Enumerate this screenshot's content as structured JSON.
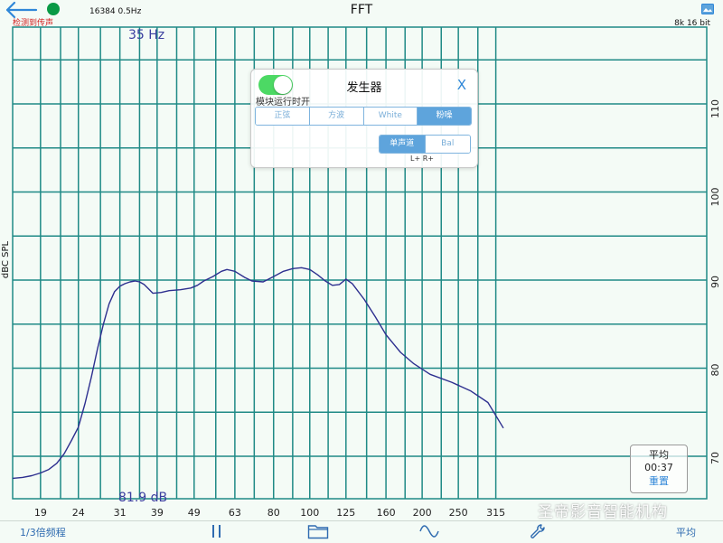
{
  "header": {
    "title": "FFT",
    "back_sublabel": "检测到传声",
    "fft_info": "16384  0.5Hz",
    "bit_info": "8k 16 bit"
  },
  "plot": {
    "y_axis_label": "dBC SPL",
    "freq_readout": "35 Hz",
    "db_readout": "81.9 dB",
    "x_ticks": [
      "19",
      "24",
      "31",
      "39",
      "49",
      "63",
      "80",
      "100",
      "125",
      "160",
      "200",
      "250",
      "315"
    ],
    "y_ticks": [
      "110",
      "100",
      "90",
      "80",
      "70"
    ],
    "grid_color": "#1f8a86",
    "curve_color": "#2d2f8f"
  },
  "chart_data": {
    "type": "line",
    "xlabel": "",
    "ylabel": "dBC SPL",
    "x_scale": "log",
    "ylim": [
      67,
      117
    ],
    "series": [
      {
        "x": [
          16,
          17,
          18,
          19,
          20,
          21,
          22,
          23,
          24,
          25,
          26,
          27,
          28,
          29,
          30,
          31,
          32,
          33,
          34,
          35,
          36,
          37,
          38,
          40,
          42,
          45,
          48,
          50,
          52,
          55,
          58,
          60,
          63,
          67,
          70,
          75,
          80,
          85,
          90,
          95,
          100,
          105,
          110,
          115,
          120,
          125,
          130,
          140,
          150,
          160,
          175,
          190,
          210,
          240,
          270,
          300,
          330
        ],
        "y": [
          67.5,
          67.6,
          67.8,
          68.1,
          68.5,
          69.2,
          70.3,
          71.8,
          73.3,
          76.0,
          79.0,
          82.2,
          85.0,
          87.3,
          88.7,
          89.3,
          89.6,
          89.8,
          89.9,
          89.8,
          89.5,
          89.0,
          88.5,
          88.6,
          88.8,
          88.9,
          89.1,
          89.4,
          89.9,
          90.4,
          91.0,
          91.2,
          91.0,
          90.3,
          89.9,
          89.8,
          90.4,
          91.0,
          91.3,
          91.4,
          91.2,
          90.6,
          89.9,
          89.4,
          89.5,
          90.1,
          89.6,
          87.8,
          85.8,
          83.8,
          81.8,
          80.5,
          79.3,
          78.4,
          77.4,
          76.1,
          73.2
        ]
      }
    ],
    "grid": true,
    "title": ""
  },
  "generator": {
    "title": "发生器",
    "close_label": "X",
    "toggle_caption": "模块运行时开",
    "toggle_on": true,
    "waveforms": [
      "正弦",
      "方波",
      "White",
      "粉噪"
    ],
    "selected_waveform": "粉噪",
    "channels": [
      "单声道",
      "Bal"
    ],
    "selected_channel": "单声道",
    "lr_label": "L+   R+"
  },
  "average": {
    "title": "平均",
    "time": "00:37",
    "reset_label": "重置"
  },
  "toolbar": {
    "octave_label": "1/3倍频程",
    "average_label": "平均",
    "pause_icon": "pause-icon",
    "folder_icon": "folder-icon",
    "wave_icon": "sine-wave-icon",
    "wrench_icon": "wrench-icon"
  },
  "watermark": "圣帝影音智能机构"
}
